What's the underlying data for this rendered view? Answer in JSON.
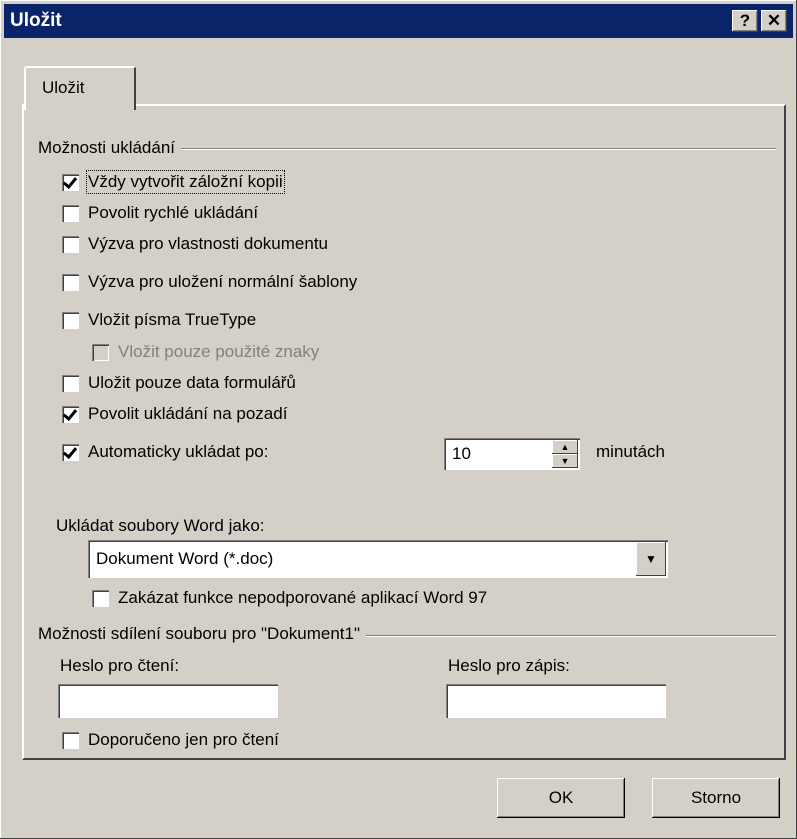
{
  "window": {
    "title": "Uložit",
    "help_label": "?",
    "close_label": "✕"
  },
  "tabs": [
    {
      "label": "Uložit"
    }
  ],
  "save_options": {
    "group_label": "Možnosti ukládání",
    "items": [
      {
        "label": "Vždy vytvořit záložní kopii",
        "checked": true
      },
      {
        "label": "Povolit rychlé ukládání",
        "checked": false
      },
      {
        "label": "Výzva pro vlastnosti dokumentu",
        "checked": false
      },
      {
        "label": "Výzva pro uložení normální šablony",
        "checked": false
      },
      {
        "label": "Vložit písma TrueType",
        "checked": false
      },
      {
        "label": "Vložit pouze použité znaky",
        "checked": false,
        "disabled": true
      },
      {
        "label": "Uložit pouze data formulářů",
        "checked": false
      },
      {
        "label": "Povolit ukládání na pozadí",
        "checked": true
      },
      {
        "label": "Automaticky ukládat po:",
        "checked": true
      }
    ],
    "autosave_value": "10",
    "autosave_unit": "minutách"
  },
  "format": {
    "label": "Ukládat soubory Word jako:",
    "selected": "Dokument Word (*.doc)",
    "disable_features_label": "Zakázat funkce nepodporované aplikací Word 97",
    "disable_features_checked": false
  },
  "sharing": {
    "group_label": "Možnosti sdílení souboru pro \"Dokument1\"",
    "read_password_label": "Heslo pro čtení:",
    "read_password_value": "",
    "write_password_label": "Heslo pro zápis:",
    "write_password_value": "",
    "readonly_recommended_label": "Doporučeno jen pro čtení",
    "readonly_recommended_checked": false
  },
  "buttons": {
    "ok": "OK",
    "cancel": "Storno"
  }
}
